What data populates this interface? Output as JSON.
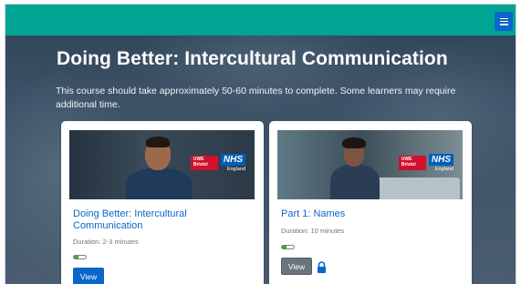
{
  "header": {
    "menu_icon": "menu-icon",
    "colors": {
      "topbar": "#00a493",
      "menu_button": "#0a66c9"
    }
  },
  "hero": {
    "title": "Doing Better: Intercultural Communication",
    "description": "This course should take approximately 50-60 minutes to complete. Some learners may require additional time."
  },
  "courses": [
    {
      "title": "Doing Better: Intercultural Communication",
      "duration": "Duration: 2-3 minutes",
      "progress": 0.35,
      "button_label": "View",
      "locked": false,
      "logo_uwe": "UWE Bristol",
      "logo_nhs": "NHS",
      "logo_nhs_sub": "England"
    },
    {
      "title": "Part 1: Names",
      "duration": "Duration: 10 minutes",
      "progress": 0.35,
      "button_label": "View",
      "locked": true,
      "logo_uwe": "UWE Bristol",
      "logo_nhs": "NHS",
      "logo_nhs_sub": "England"
    }
  ]
}
